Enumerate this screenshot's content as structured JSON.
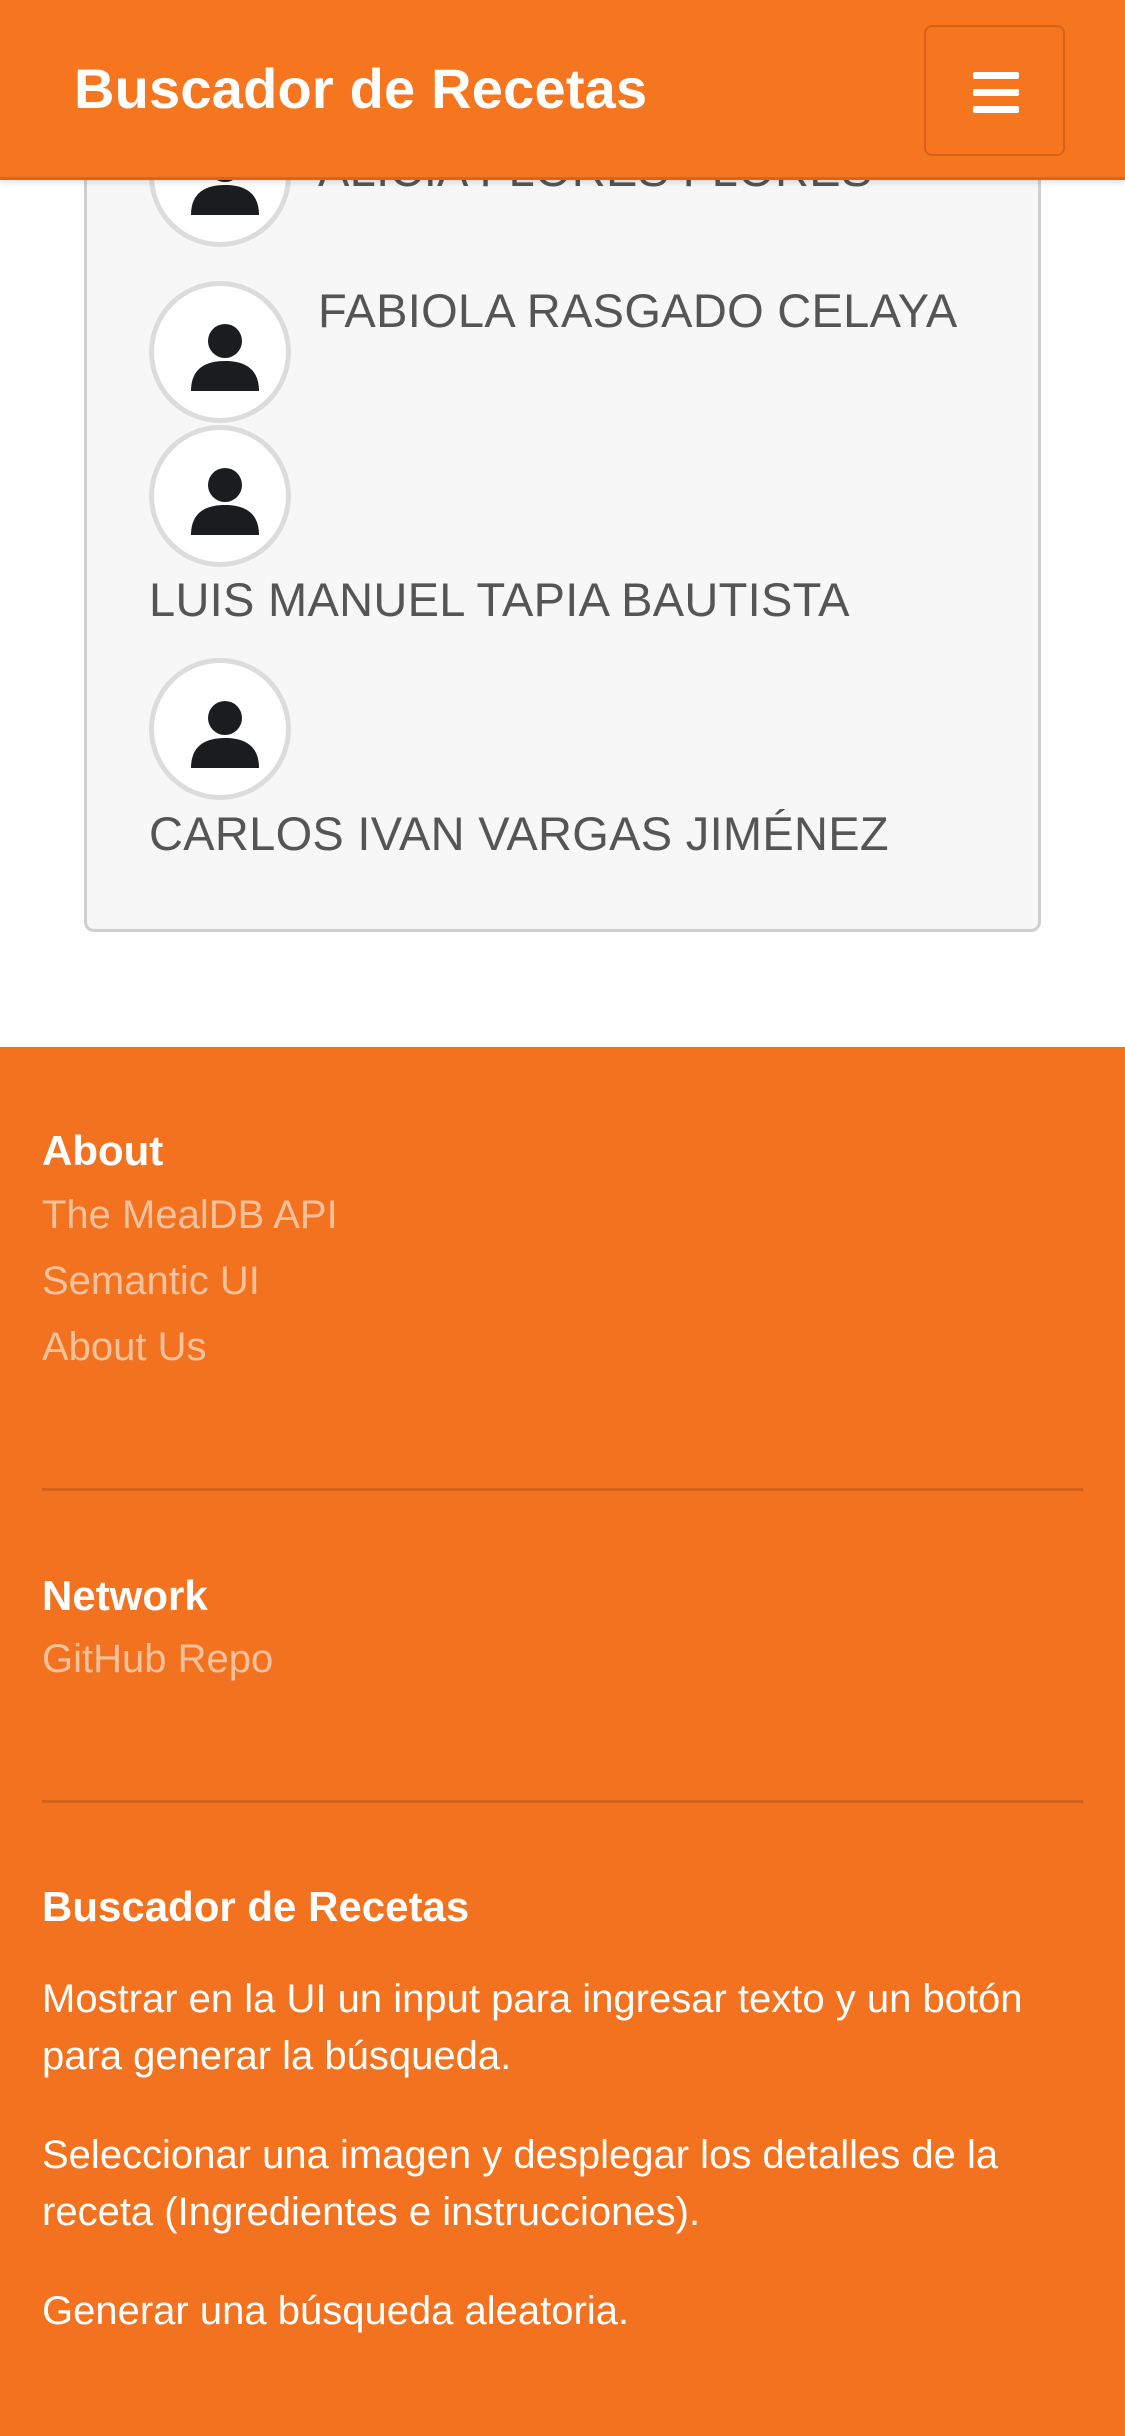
{
  "header": {
    "brand": "Buscador de Recetas",
    "menu_icon": "hamburger-menu-icon"
  },
  "team": {
    "members": [
      {
        "name": "ALICIA FLORES FLORES",
        "icon": "user-icon"
      },
      {
        "name": "FABIOLA RASGADO CELAYA",
        "icon": "user-icon"
      },
      {
        "name": "LUIS MANUEL TAPIA BAUTISTA",
        "icon": "user-icon"
      },
      {
        "name": "CARLOS IVAN VARGAS JIMÉNEZ",
        "icon": "user-icon"
      }
    ]
  },
  "footer": {
    "about": {
      "title": "About",
      "links": [
        "The MealDB API",
        "Semantic UI",
        "About Us"
      ]
    },
    "network": {
      "title": "Network",
      "links": [
        "GitHub Repo"
      ]
    },
    "project": {
      "title": "Buscador de Recetas",
      "paragraphs": [
        "Mostrar en la UI un input para ingresar texto y un botón para generar la búsqueda.",
        "Seleccionar una imagen y desplegar los detalles de la receta (Ingredientes e instrucciones).",
        "Generar una búsqueda aleatoria."
      ]
    }
  },
  "colors": {
    "accent": "#f5761e",
    "footer_bg": "#f2721f",
    "link": "#f6c29d",
    "card_bg": "#f7f7f7"
  }
}
